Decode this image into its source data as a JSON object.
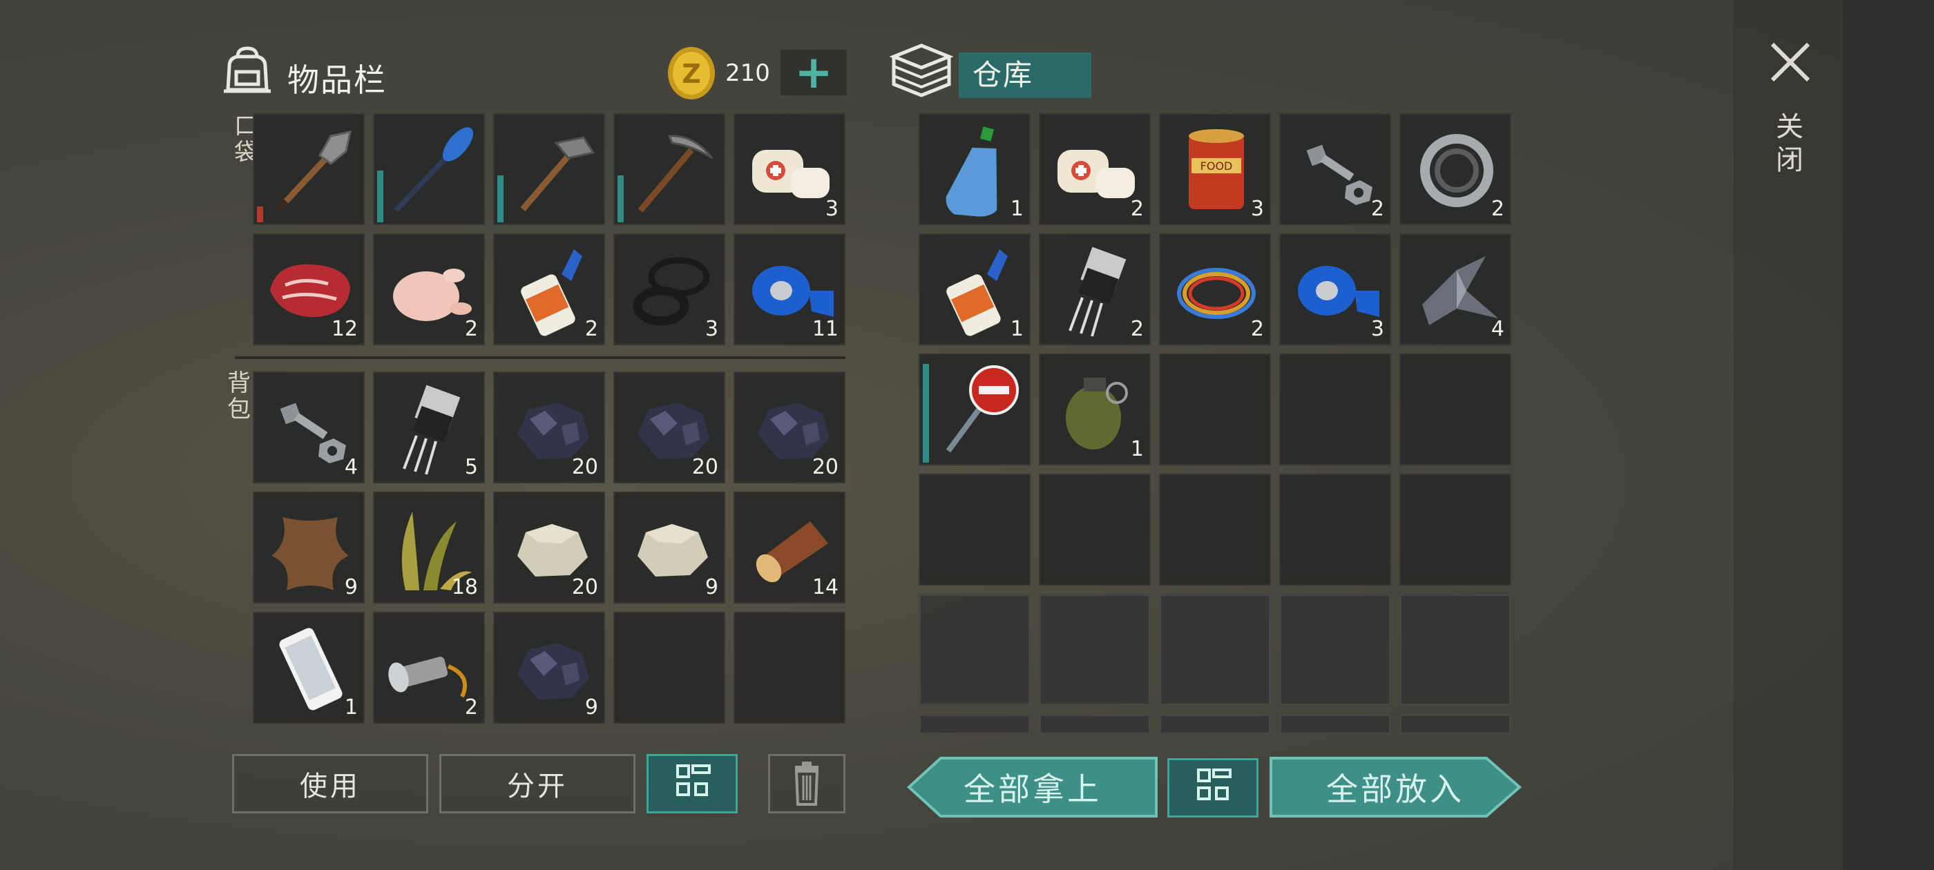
{
  "inventory": {
    "title": "物品栏",
    "currency": {
      "amount": "210",
      "add_label": "+"
    },
    "section_pocket": "口袋",
    "section_backpack": "背包",
    "pocket": [
      {
        "icon": "shovel-icon",
        "count": "",
        "durability": 0.15,
        "dur_color": "#b23a2a"
      },
      {
        "icon": "paddle-icon",
        "count": "",
        "durability": 0.5,
        "dur_color": "#2f8a86"
      },
      {
        "icon": "stone-hammer-icon",
        "count": "",
        "durability": 0.45,
        "dur_color": "#2f8a86"
      },
      {
        "icon": "pickaxe-icon",
        "count": "",
        "durability": 0.45,
        "dur_color": "#2f8a86"
      },
      {
        "icon": "bandage-icon",
        "count": "3"
      },
      {
        "icon": "raw-meat-icon",
        "count": "12"
      },
      {
        "icon": "raw-chicken-icon",
        "count": "2"
      },
      {
        "icon": "glue-icon",
        "count": "2"
      },
      {
        "icon": "rubber-ring-icon",
        "count": "3"
      },
      {
        "icon": "blue-tape-icon",
        "count": "11"
      }
    ],
    "backpack": [
      {
        "icon": "bolt-nut-icon",
        "count": "4"
      },
      {
        "icon": "transistor-icon",
        "count": "5"
      },
      {
        "icon": "coal-ore-icon",
        "count": "20"
      },
      {
        "icon": "coal-ore-icon",
        "count": "20"
      },
      {
        "icon": "coal-ore-icon",
        "count": "20"
      },
      {
        "icon": "animal-hide-icon",
        "count": "9"
      },
      {
        "icon": "plant-fiber-icon",
        "count": "18"
      },
      {
        "icon": "stone-icon",
        "count": "20"
      },
      {
        "icon": "stone-icon",
        "count": "9"
      },
      {
        "icon": "log-icon",
        "count": "14"
      },
      {
        "icon": "smartphone-icon",
        "count": "1"
      },
      {
        "icon": "flashlight-icon",
        "count": "2"
      },
      {
        "icon": "coal-ore-icon",
        "count": "9"
      },
      {
        "icon": "",
        "count": ""
      },
      {
        "icon": "",
        "count": ""
      }
    ],
    "buttons": {
      "use": "使用",
      "split": "分开"
    }
  },
  "storage": {
    "title": "仓库",
    "slots": [
      {
        "icon": "water-bottle-icon",
        "count": "1"
      },
      {
        "icon": "bandage-icon",
        "count": "2"
      },
      {
        "icon": "food-can-icon",
        "count": "3"
      },
      {
        "icon": "bolt-nut-icon",
        "count": "2"
      },
      {
        "icon": "bearing-icon",
        "count": "2"
      },
      {
        "icon": "glue-icon",
        "count": "1"
      },
      {
        "icon": "transistor-icon",
        "count": "2"
      },
      {
        "icon": "wires-icon",
        "count": "2"
      },
      {
        "icon": "blue-tape-icon",
        "count": "3"
      },
      {
        "icon": "scrap-metal-icon",
        "count": "4"
      },
      {
        "icon": "stop-sign-icon",
        "count": "",
        "durability": 0.95,
        "dur_color": "#2f8a86"
      },
      {
        "icon": "grenade-icon",
        "count": "1"
      },
      {
        "icon": "",
        "count": ""
      },
      {
        "icon": "",
        "count": ""
      },
      {
        "icon": "",
        "count": ""
      },
      {
        "icon": "",
        "count": ""
      },
      {
        "icon": "",
        "count": ""
      },
      {
        "icon": "",
        "count": ""
      },
      {
        "icon": "",
        "count": ""
      },
      {
        "icon": "",
        "count": ""
      }
    ],
    "locked_rows": 2,
    "buttons": {
      "take_all": "全部拿上",
      "put_all": "全部放入"
    }
  },
  "close_label": "关闭",
  "colors": {
    "accent": "#2b6a66",
    "accent_border": "#3fa598",
    "durability": "#2f8a86",
    "durability_low": "#b23a2a"
  }
}
